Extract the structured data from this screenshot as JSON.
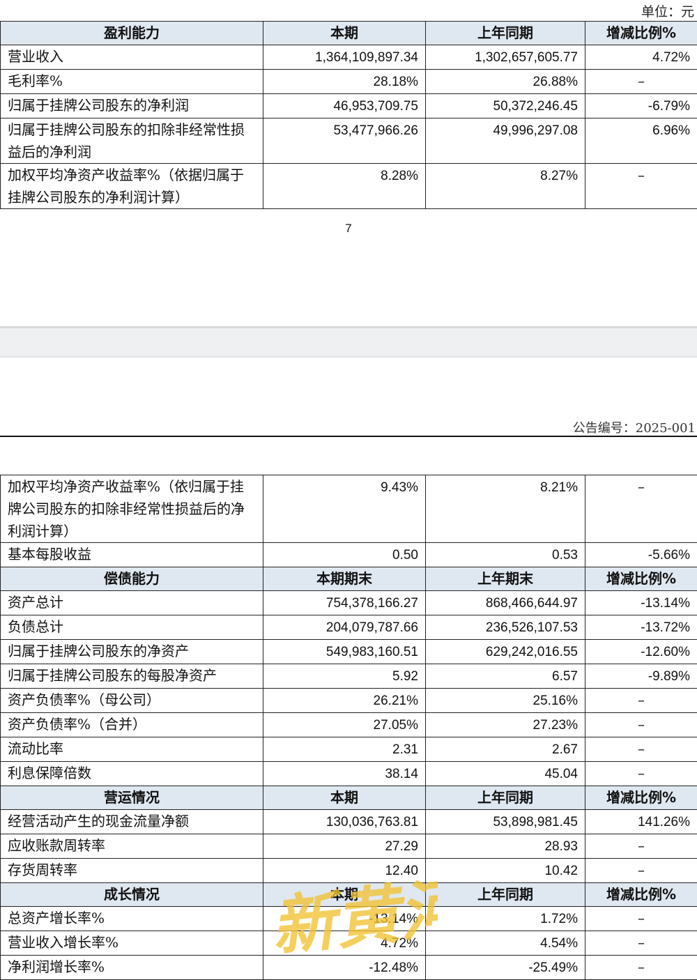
{
  "unit_label": "单位：元",
  "page_number": "7",
  "announcement_no": "公告编号：2025-001",
  "watermark_text": "新黄河",
  "watermark_color": "#f2c232",
  "header_bg": "#dfe7f0",
  "table1": {
    "header": [
      "盈利能力",
      "本期",
      "上年同期",
      "增减比例%"
    ],
    "rows": [
      [
        "营业收入",
        "1,364,109,897.34",
        "1,302,657,605.77",
        "4.72%"
      ],
      [
        "毛利率%",
        "28.18%",
        "26.88%",
        "–"
      ],
      [
        "归属于挂牌公司股东的净利润",
        "46,953,709.75",
        "50,372,246.45",
        "-6.79%"
      ],
      [
        "归属于挂牌公司股东的扣除非经常性损益后的净利润",
        "53,477,966.26",
        "49,996,297.08",
        "6.96%"
      ],
      [
        "加权平均净资产收益率%（依据归属于挂牌公司股东的净利润计算）",
        "8.28%",
        "8.27%",
        "–"
      ]
    ]
  },
  "table2": {
    "rows_top": [
      [
        "加权平均净资产收益率%（依归属于挂牌公司股东的扣除非经常性损益后的净利润计算）",
        "9.43%",
        "8.21%",
        "–"
      ],
      [
        "基本每股收益",
        "0.50",
        "0.53",
        "-5.66%"
      ]
    ],
    "header_solvency": [
      "偿债能力",
      "本期期末",
      "上年期末",
      "增减比例%"
    ],
    "rows_solvency": [
      [
        "资产总计",
        "754,378,166.27",
        "868,466,644.97",
        "-13.14%"
      ],
      [
        "负债总计",
        "204,079,787.66",
        "236,526,107.53",
        "-13.72%"
      ],
      [
        "归属于挂牌公司股东的净资产",
        "549,983,160.51",
        "629,242,016.55",
        "-12.60%"
      ],
      [
        "归属于挂牌公司股东的每股净资产",
        "5.92",
        "6.57",
        "-9.89%"
      ],
      [
        "资产负债率%（母公司）",
        "26.21%",
        "25.16%",
        "–"
      ],
      [
        "资产负债率%（合并）",
        "27.05%",
        "27.23%",
        "–"
      ],
      [
        "流动比率",
        "2.31",
        "2.67",
        "–"
      ],
      [
        "利息保障倍数",
        "38.14",
        "45.04",
        "–"
      ]
    ],
    "header_operation": [
      "营运情况",
      "本期",
      "上年同期",
      "增减比例%"
    ],
    "rows_operation": [
      [
        "经营活动产生的现金流量净额",
        "130,036,763.81",
        "53,898,981.45",
        "141.26%"
      ],
      [
        "应收账款周转率",
        "27.29",
        "28.93",
        "–"
      ],
      [
        "存货周转率",
        "12.40",
        "10.42",
        "–"
      ]
    ],
    "header_growth": [
      "成长情况",
      "本期",
      "上年同期",
      "增减比例%"
    ],
    "rows_growth": [
      [
        "总资产增长率%",
        "-13.14%",
        "1.72%",
        "–"
      ],
      [
        "营业收入增长率%",
        "4.72%",
        "4.54%",
        "–"
      ],
      [
        "净利润增长率%",
        "-12.48%",
        "-25.49%",
        "–"
      ]
    ]
  }
}
